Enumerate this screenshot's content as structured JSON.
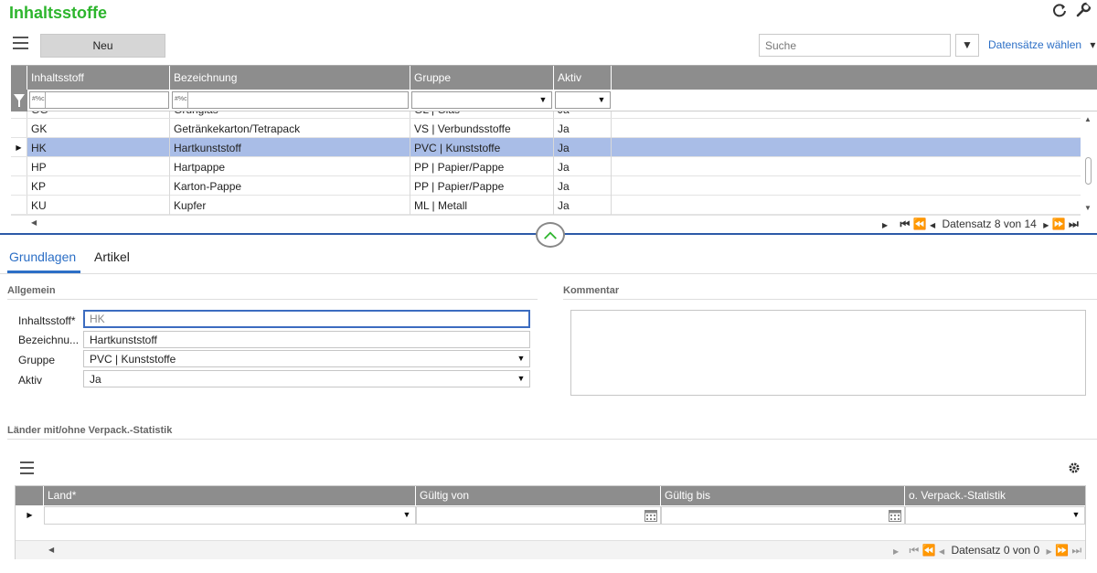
{
  "header": {
    "title": "Inhaltsstoffe",
    "icons": [
      "refresh-icon",
      "wrench-icon"
    ]
  },
  "toolbar": {
    "new_label": "Neu",
    "search_placeholder": "Suche",
    "filter_glyph": "▼",
    "records_select_label": "Datensätze wählen",
    "records_select_arrow": "▾"
  },
  "grid": {
    "columns": [
      "Inhaltsstoff",
      "Bezeichnung",
      "Gruppe",
      "Aktiv"
    ],
    "filter_placeholder": "#%c",
    "partial_row": [
      "GG",
      "Grünglas",
      "GL | Glas",
      "Ja"
    ],
    "rows": [
      {
        "code": "GK",
        "name": "Getränkekarton/Tetrapack",
        "group": "VS  |  Verbundsstoffe",
        "active": "Ja",
        "selected": false
      },
      {
        "code": "HK",
        "name": "Hartkunststoff",
        "group": "PVC  |  Kunststoffe",
        "active": "Ja",
        "selected": true
      },
      {
        "code": "HP",
        "name": "Hartpappe",
        "group": "PP  |  Papier/Pappe",
        "active": "Ja",
        "selected": false
      },
      {
        "code": "KP",
        "name": "Karton-Pappe",
        "group": "PP  |  Papier/Pappe",
        "active": "Ja",
        "selected": false
      },
      {
        "code": "KU",
        "name": "Kupfer",
        "group": "ML  |  Metall",
        "active": "Ja",
        "selected": false
      }
    ],
    "pager_text": "Datensatz 8 von 14"
  },
  "tabs": [
    {
      "label": "Grundlagen",
      "active": true
    },
    {
      "label": "Artikel",
      "active": false
    }
  ],
  "form": {
    "section_general": "Allgemein",
    "section_comment": "Kommentar",
    "fields": {
      "inhaltsstoff_label": "Inhaltsstoff*",
      "inhaltsstoff_value": "HK",
      "bezeichnung_label": "Bezeichnu...",
      "bezeichnung_value": "Hartkunststoff",
      "gruppe_label": "Gruppe",
      "gruppe_value": "PVC  |  Kunststoffe",
      "aktiv_label": "Aktiv",
      "aktiv_value": "Ja"
    }
  },
  "countries": {
    "section_title": "Länder mit/ohne Verpack.-Statistik",
    "columns": [
      "Land*",
      "Gültig von",
      "Gültig bis",
      "o. Verpack.-Statistik"
    ],
    "pager_text": "Datensatz 0 von 0"
  },
  "colors": {
    "title_green": "#2db52d",
    "accent_blue": "#2c6fc6",
    "header_gray": "#8d8d8d",
    "selected_row": "#a9bde7"
  }
}
